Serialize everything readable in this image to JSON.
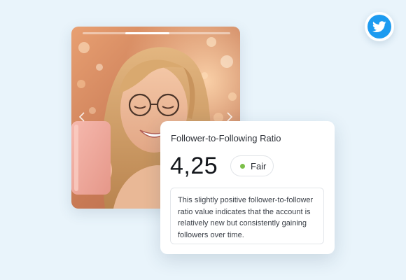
{
  "social": {
    "icon": "twitter-bird-icon",
    "color": "#1d9bf0"
  },
  "photo": {
    "description_icon": "profile-photo",
    "story_progress": 0.3,
    "story_segment_index": 1,
    "prev_icon": "chevron-left-icon",
    "next_icon": "chevron-right-icon"
  },
  "ratio_card": {
    "title": "Follower-to-Following Ratio",
    "value": "4,25",
    "status": {
      "label": "Fair",
      "color": "#7cbf4a"
    },
    "description": "This slightly positive follower-to-follower ratio value indicates that the account is relatively new but consistently gaining followers over time."
  }
}
